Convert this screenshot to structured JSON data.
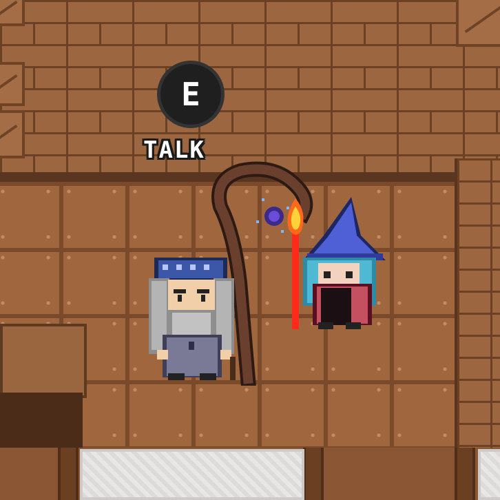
{
  "prompt": {
    "key": "E",
    "action": "TALK"
  },
  "characters": [
    {
      "name": "old-wizard",
      "icon": "old-wizard-sprite"
    },
    {
      "name": "witch-player",
      "icon": "witch-sprite"
    }
  ],
  "colors": {
    "badge": "#1f1f1f",
    "label": "#ffffff",
    "brick": "#9b6640",
    "floor": "#a0673e",
    "witch_hat": "#4f5fd6",
    "wizard_robe": "#6f6f8f",
    "fire": "#ff3b2f"
  }
}
